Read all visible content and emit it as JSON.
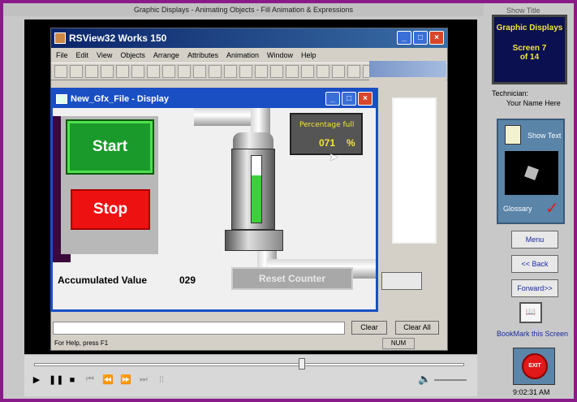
{
  "course_title": "Graphic Displays - Animating Objects - Fill Animation & Expressions",
  "rsview": {
    "title": "RSView32 Works 150",
    "menu": [
      "File",
      "Edit",
      "View",
      "Objects",
      "Arrange",
      "Attributes",
      "Animation",
      "Window",
      "Help"
    ],
    "status": "For Help, press F1",
    "num_indicator": "NUM",
    "clear_label": "Clear",
    "clear_all_label": "Clear All"
  },
  "display": {
    "title": "New_Gfx_File - Display",
    "start_label": "Start",
    "stop_label": "Stop",
    "percentage_title": "Percentage full",
    "percentage_value": "071",
    "percentage_unit": "%",
    "fill_level": 0.71,
    "accumulated_label": "Accumulated Value",
    "accumulated_value": "029",
    "reset_label": "Reset Counter"
  },
  "sidebar": {
    "header_check": "Show Title",
    "screen_title": "Graphic Displays",
    "screen_line1": "Screen 7",
    "screen_line2": "of 14",
    "technician_label": "Technician:",
    "technician_name": "Your Name Here",
    "show_text": "Show Text",
    "glossary": "Glossary",
    "menu_btn": "Menu",
    "back_btn": "<< Back",
    "forward_btn": "Forward>>",
    "bookmark": "BookMark this Screen",
    "exit": "EXIT",
    "clock": "9:02:31 AM"
  },
  "colors": {
    "frame_border": "#8a1a8a",
    "start_green": "#1a9a2a",
    "stop_red": "#ee1111",
    "tank_fill": "#3ad23a",
    "title_blue": "#1a4fc4"
  }
}
